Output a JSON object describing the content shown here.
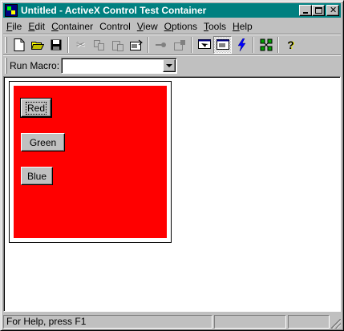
{
  "window": {
    "title": "Untitled - ActiveX Control Test Container"
  },
  "menu": [
    {
      "label": "File",
      "u": "F",
      "rest": "ile"
    },
    {
      "label": "Edit",
      "u": "E",
      "rest": "dit"
    },
    {
      "label": "Container",
      "u": "C",
      "rest": "ontainer"
    },
    {
      "label": "Control",
      "u": "C",
      "rest": "ontrol",
      "pre": ""
    },
    {
      "label": "View",
      "u": "V",
      "rest": "iew"
    },
    {
      "label": "Options",
      "u": "O",
      "rest": "ptions"
    },
    {
      "label": "Tools",
      "u": "T",
      "rest": "ools"
    },
    {
      "label": "Help",
      "u": "H",
      "rest": "elp"
    }
  ],
  "toolbar": {
    "icons": {
      "new": "new-document-icon",
      "open": "open-folder-icon",
      "save": "save-disk-icon",
      "cut": "cut-icon",
      "copy": "copy-icon",
      "paste": "paste-icon",
      "insert_control": "insert-control-icon",
      "invoke": "invoke-methods-icon",
      "properties": "properties-icon",
      "design_mode": "design-mode-icon",
      "run_mode": "run-mode-icon",
      "events": "events-lightning-icon",
      "ambient": "ambient-properties-icon",
      "help": "help-icon"
    }
  },
  "macro": {
    "label": "Run Macro:",
    "value": ""
  },
  "control": {
    "background": "#ff0000",
    "buttons": [
      {
        "label": "Red"
      },
      {
        "label": "Green"
      },
      {
        "label": "Blue"
      }
    ]
  },
  "status": {
    "text": "For Help, press F1",
    "pane2": "",
    "pane3": ""
  },
  "colors": {
    "title_bar": "#008080",
    "face": "#c0c0c0",
    "control_fill": "#ff0000"
  }
}
